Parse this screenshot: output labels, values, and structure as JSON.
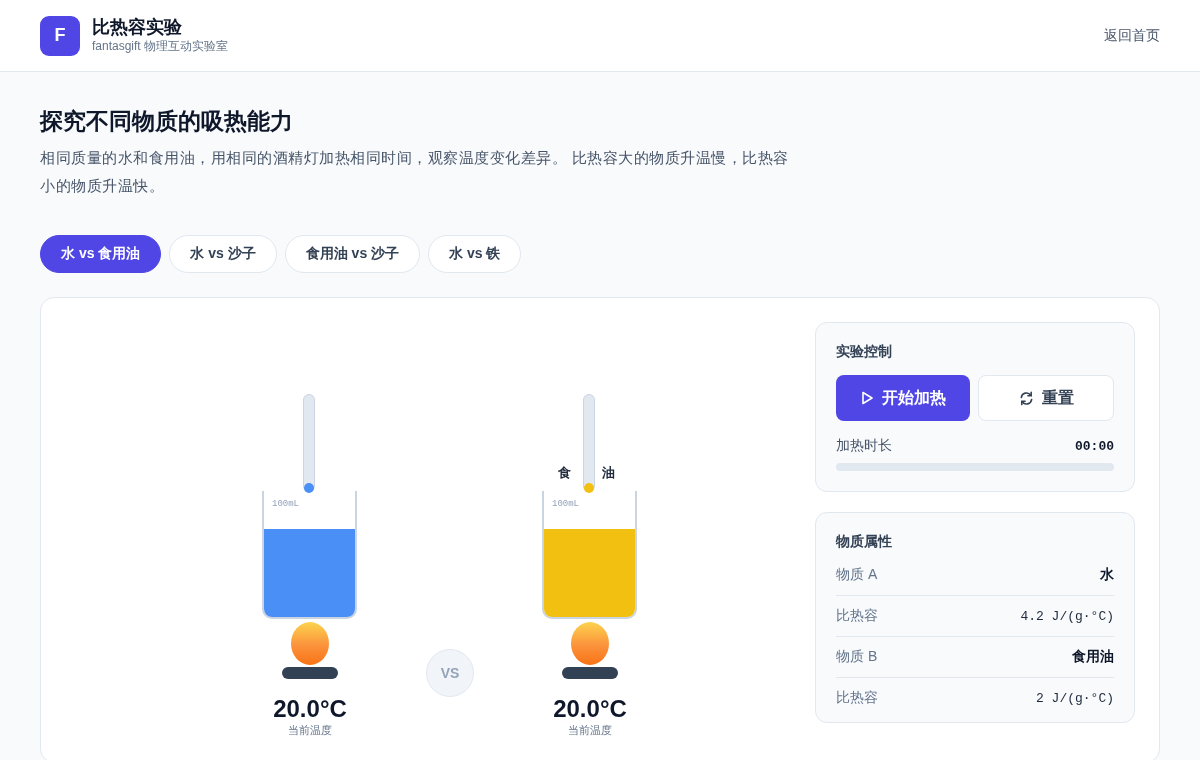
{
  "header": {
    "logo": "F",
    "title": "比热容实验",
    "subtitle": "fantasgift 物理互动实验室",
    "home_link": "返回首页"
  },
  "intro": {
    "title": "探究不同物质的吸热能力",
    "description": "相同质量的水和食用油，用相同的酒精灯加热相同时间，观察温度变化差异。 比热容大的物质升温慢，比热容小的物质升温快。"
  },
  "tabs": [
    {
      "label": "水 vs 食用油",
      "selected": true
    },
    {
      "label": "水 vs 沙子",
      "selected": false
    },
    {
      "label": "食用油 vs 沙子",
      "selected": false
    },
    {
      "label": "水 vs 铁",
      "selected": false
    }
  ],
  "beakers": [
    {
      "volume_mark": "100mL",
      "color": "#4a8ff5",
      "temperature": "20.0°C",
      "temperature_label": "当前温度"
    },
    {
      "label_parts": [
        "食",
        "油"
      ],
      "volume_mark": "100mL",
      "color": "#f2c010",
      "temperature": "20.0°C",
      "temperature_label": "当前温度"
    }
  ],
  "vs_badge": "VS",
  "control": {
    "title": "实验控制",
    "start_button": "开始加热",
    "reset_button": "重置",
    "duration_label": "加热时长",
    "duration_value": "00:00",
    "level": 0
  },
  "properties": {
    "title": "物质属性",
    "rows": [
      {
        "label": "物质 A",
        "value": "水",
        "kind": "name"
      },
      {
        "label": "比热容",
        "value": "4.2 J/(g·°C)",
        "kind": "number"
      },
      {
        "label": "物质 B",
        "value": "食用油",
        "kind": "name"
      },
      {
        "label": "比热容",
        "value": "2 J/(g·°C)",
        "kind": "number"
      }
    ]
  }
}
